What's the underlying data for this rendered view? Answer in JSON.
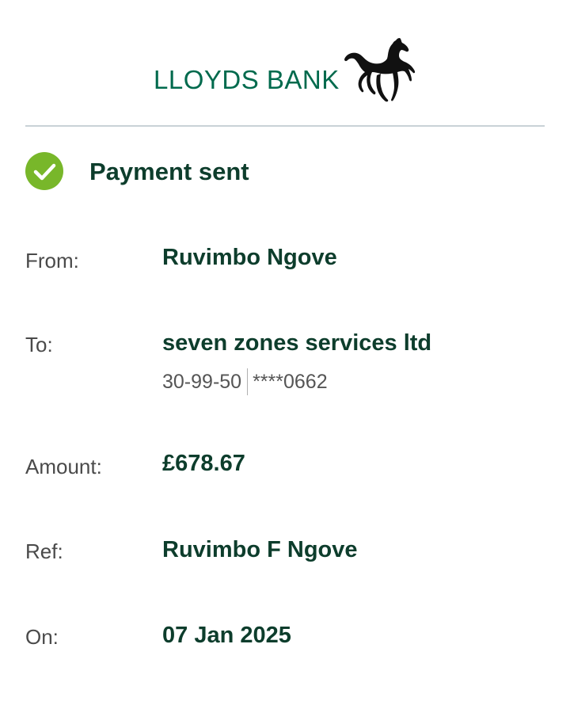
{
  "brand": {
    "name": "LLOYDS BANK",
    "logo_icon": "black-horse-icon",
    "color": "#006a4d"
  },
  "status": {
    "icon": "check-circle-icon",
    "icon_color": "#78b72a",
    "text": "Payment sent"
  },
  "details": {
    "from_label": "From:",
    "from_value": "Ruvimbo Ngove",
    "to_label": "To:",
    "to_value": "seven zones services ltd",
    "to_sort_code": "30-99-50",
    "to_account": "****0662",
    "amount_label": "Amount:",
    "amount_value": "£678.67",
    "ref_label": "Ref:",
    "ref_value": "Ruvimbo F Ngove",
    "on_label": "On:",
    "on_value": "07 Jan 2025"
  },
  "colors": {
    "text_primary": "#0d3d2c",
    "label": "#4a4a4a",
    "divider": "#c9d2d7"
  }
}
